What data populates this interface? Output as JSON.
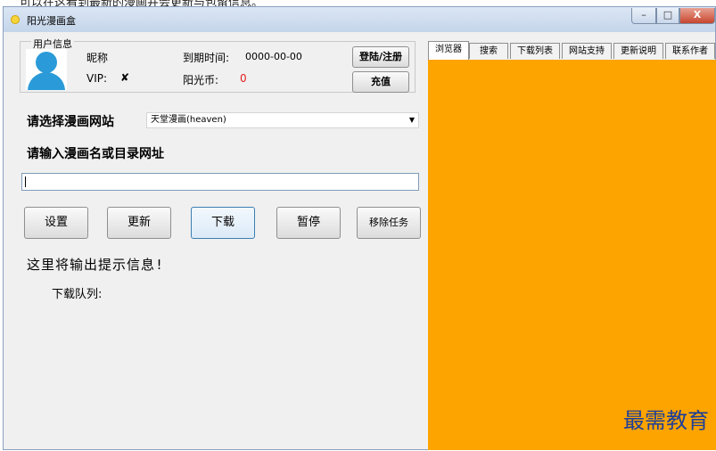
{
  "caption": "可以在这看到最新的漫画并会更新与包留信息。",
  "window": {
    "title": "阳光漫画盒",
    "minimize": "–",
    "maximize": "□",
    "close": "X"
  },
  "user_info": {
    "group_label": "用户信息",
    "nickname_label": "昵称",
    "vip_label": "VIP:",
    "vip_status": "✘",
    "expire_label": "到期时间:",
    "expire_value": "0000-00-00",
    "coin_label": "阳光币:",
    "coin_value": "0",
    "login_button": "登陆/注册",
    "recharge_button": "充值"
  },
  "site": {
    "label": "请选择漫画网站",
    "selected": "天堂漫画(heaven)"
  },
  "comic": {
    "label": "请输入漫画名或目录网址",
    "value": ""
  },
  "actions": {
    "settings": "设置",
    "update": "更新",
    "download": "下载",
    "pause": "暂停",
    "remove": "移除任务"
  },
  "output": {
    "hint": "这里将输出提示信息!",
    "queue_label": "下载队列:"
  },
  "tabs": [
    {
      "label": "浏览器",
      "active": true
    },
    {
      "label": "搜索",
      "active": false
    },
    {
      "label": "下载列表",
      "active": false
    },
    {
      "label": "网站支持",
      "active": false
    },
    {
      "label": "更新说明",
      "active": false
    },
    {
      "label": "联系作者",
      "active": false
    }
  ],
  "browser": {
    "background": "#fda400"
  },
  "watermark": "最需教育",
  "colors": {
    "accent": "#2a9bd8",
    "coin": "#e02020",
    "watermark": "#1d3f99"
  }
}
